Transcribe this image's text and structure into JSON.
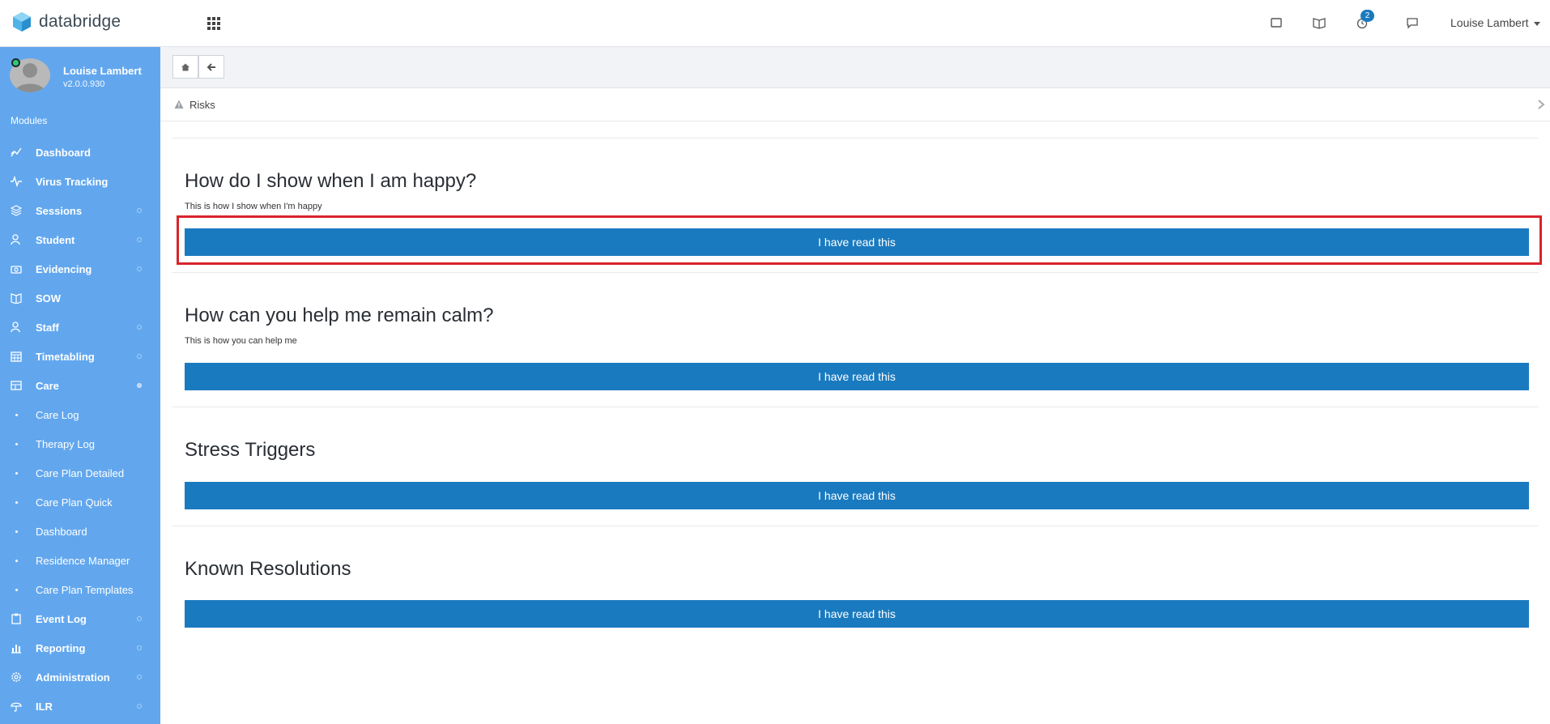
{
  "app": {
    "name": "databridge"
  },
  "header": {
    "notification_count": "2",
    "user_name": "Louise Lambert",
    "icons": [
      "tablet-icon",
      "book-icon",
      "alarm-clock-icon",
      "chat-icon"
    ]
  },
  "sidebar": {
    "profile": {
      "name": "Louise Lambert",
      "version": "v2.0.0.930"
    },
    "modules_label": "Modules",
    "items": [
      {
        "label": "Dashboard",
        "icon": "line-chart-icon"
      },
      {
        "label": "Virus Tracking",
        "icon": "pulse-icon"
      },
      {
        "label": "Sessions",
        "icon": "layers-icon"
      },
      {
        "label": "Student",
        "icon": "users-icon"
      },
      {
        "label": "Evidencing",
        "icon": "camera-icon"
      },
      {
        "label": "SOW",
        "icon": "book-icon"
      },
      {
        "label": "Staff",
        "icon": "users-icon"
      },
      {
        "label": "Timetabling",
        "icon": "calendar-icon"
      },
      {
        "label": "Care",
        "icon": "clipboard-icon"
      },
      {
        "label": "Care Log"
      },
      {
        "label": "Therapy Log"
      },
      {
        "label": "Care Plan Detailed"
      },
      {
        "label": "Care Plan Quick"
      },
      {
        "label": "Dashboard"
      },
      {
        "label": "Residence Manager"
      },
      {
        "label": "Care Plan Templates"
      },
      {
        "label": "Event Log",
        "icon": "clipboard-list-icon"
      },
      {
        "label": "Reporting",
        "icon": "bar-chart-icon"
      },
      {
        "label": "Administration",
        "icon": "gear-icon"
      },
      {
        "label": "ILR",
        "icon": "umbrella-icon"
      }
    ]
  },
  "breadcrumb": {
    "label": "Risks"
  },
  "sections": [
    {
      "title": "How do I show when I am happy?",
      "description": "This is how I show when I'm happy",
      "button": "I have read this"
    },
    {
      "title": "How can you help me remain calm?",
      "description": "This is how you can help me",
      "button": "I have read this"
    },
    {
      "title": "Stress Triggers",
      "description": "",
      "button": "I have read this"
    },
    {
      "title": "Known Resolutions",
      "description": "",
      "button": "I have read this"
    }
  ],
  "colors": {
    "sidebar": "#62a7ee",
    "primary_button": "#1a7abf",
    "highlight": "#d8242b",
    "badge": "#1a7abf"
  }
}
